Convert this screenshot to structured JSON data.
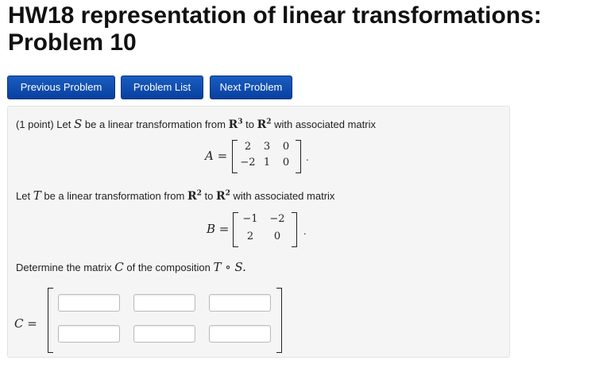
{
  "page": {
    "title_line1": "HW18 representation of linear transformations:",
    "title_line2": "Problem 10"
  },
  "nav": {
    "prev": "Previous Problem",
    "list": "Problem List",
    "next": "Next Problem"
  },
  "problem": {
    "intro_prefix": "(1 point) Let",
    "S": "S",
    "intro_mid": "be a linear transformation from",
    "R3_base": "R",
    "R3_exp": "3",
    "to1": "to",
    "R2_base": "R",
    "R2_exp": "2",
    "intro_suffix": "with associated matrix",
    "A_label": "A =",
    "A": [
      [
        "2",
        "3",
        "0"
      ],
      [
        "−2",
        "1",
        "0"
      ]
    ],
    "period": ".",
    "second_prefix": "Let",
    "T": "T",
    "second_mid": "be a linear transformation from",
    "R2b_base": "R",
    "R2b_exp": "2",
    "to2": "to",
    "R2c_base": "R",
    "R2c_exp": "2",
    "second_suffix": "with associated matrix",
    "B_label": "B =",
    "B": [
      [
        "−1",
        "−2"
      ],
      [
        "2",
        "0"
      ]
    ],
    "determine_prefix": "Determine the matrix",
    "C": "C",
    "determine_mid": "of the composition",
    "comp": "T ∘ S.",
    "C_label": "C ="
  }
}
